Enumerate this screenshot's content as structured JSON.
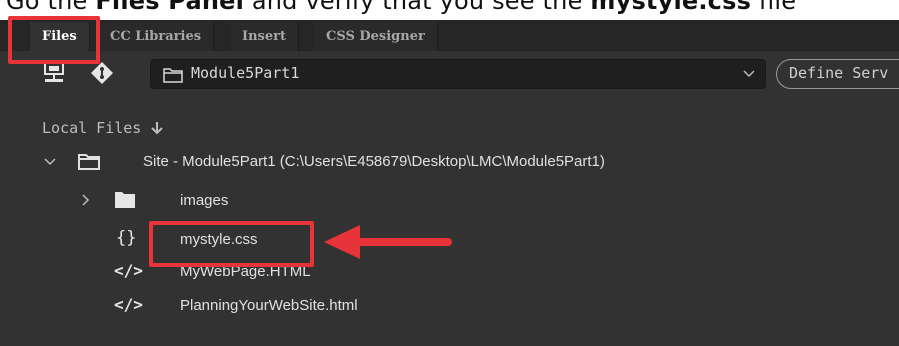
{
  "caption": {
    "prefix": "Go the ",
    "bold1": "Files Panel",
    "middle": " and verify that you see the ",
    "bold2": "mystyle.css",
    "suffix": " file"
  },
  "tabs": [
    {
      "label": "Files",
      "active": true
    },
    {
      "label": "CC Libraries",
      "active": false
    },
    {
      "label": "Insert",
      "active": false
    },
    {
      "label": "CSS Designer",
      "active": false
    }
  ],
  "toolbar": {
    "connect_icon": "connect-server-icon",
    "git_icon": "git-icon",
    "site_name": "Module5Part1",
    "define_button": "Define Serv"
  },
  "local_files_label": "Local Files",
  "tree": {
    "site_label": "Site - Module5Part1 (C:\\Users\\E458679\\Desktop\\LMC\\Module5Part1)",
    "items": [
      {
        "icon": "folder-icon",
        "label": "images"
      },
      {
        "icon": "css-braces-icon",
        "label": "mystyle.css"
      },
      {
        "icon": "html-code-icon",
        "label": "MyWebPage.HTML"
      },
      {
        "icon": "html-code-icon",
        "label": "PlanningYourWebSite.html"
      }
    ]
  },
  "colors": {
    "highlight": "#e8333a",
    "panel_bg": "#323232",
    "tabbar_bg": "#262626"
  }
}
